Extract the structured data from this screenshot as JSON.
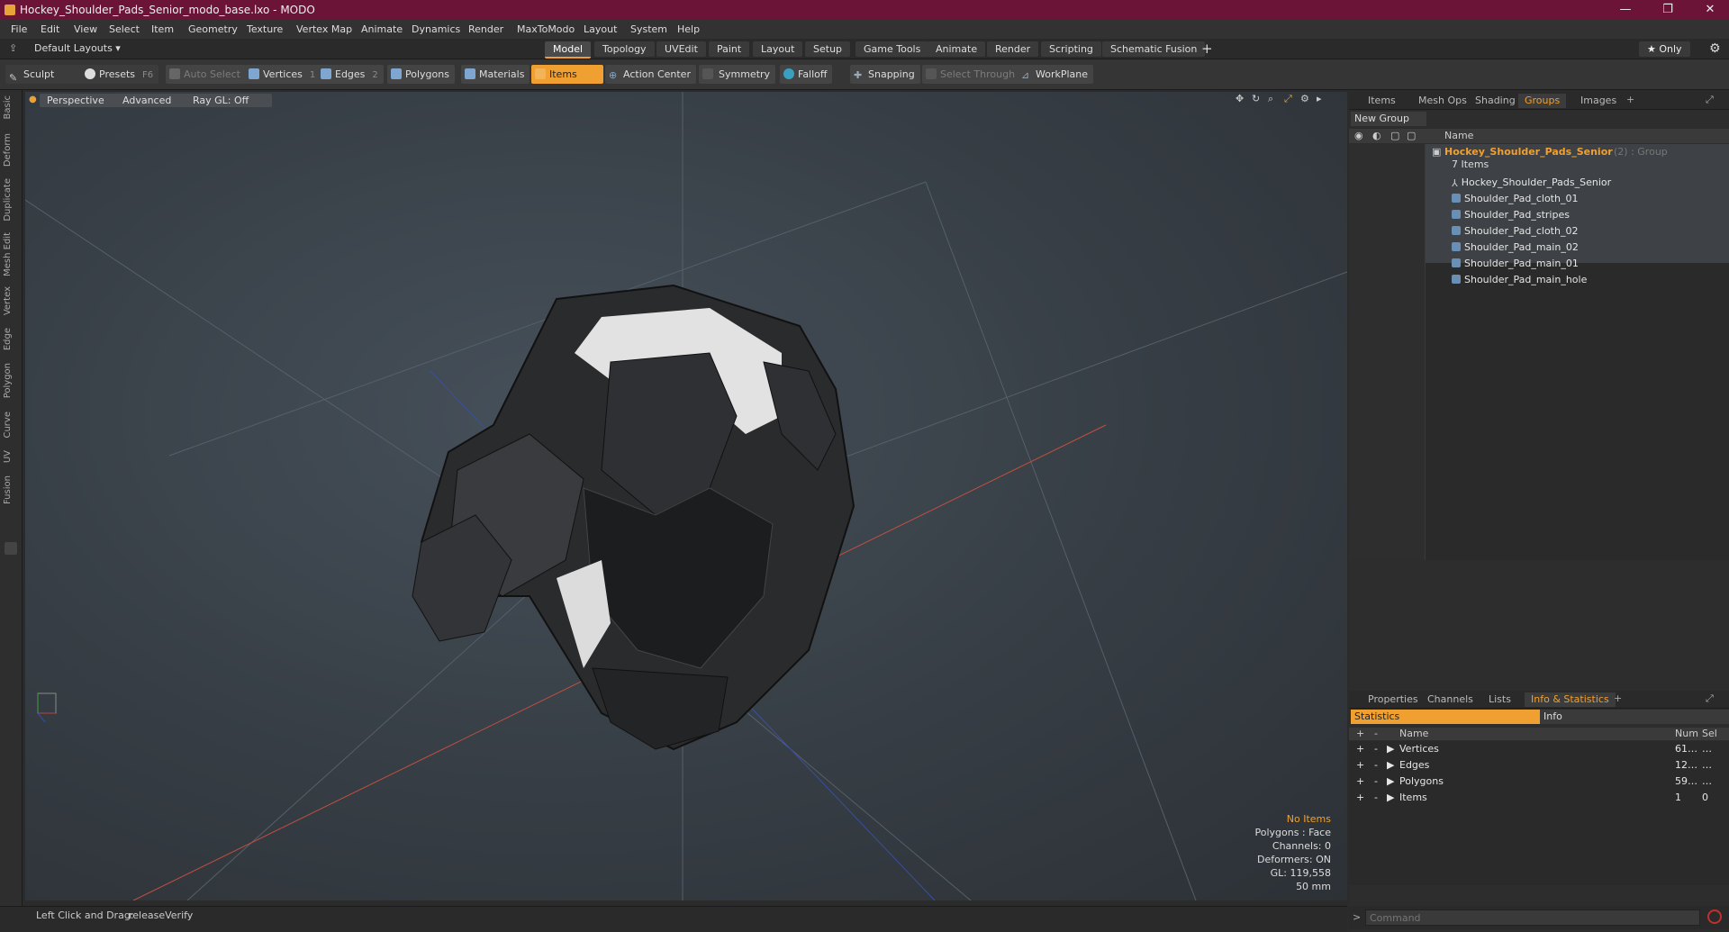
{
  "window": {
    "title": "Hockey_Shoulder_Pads_Senior_modo_base.lxo - MODO",
    "minimize_glyph": "—",
    "restore_glyph": "❐",
    "close_glyph": "✕"
  },
  "menu": [
    "File",
    "Edit",
    "View",
    "Select",
    "Item",
    "Geometry",
    "Texture",
    "Vertex Map",
    "Animate",
    "Dynamics",
    "Render",
    "MaxToModo",
    "Layout",
    "System",
    "Help"
  ],
  "layoutbar": {
    "preset": "Default Layouts ▾",
    "tabs": [
      "Model",
      "Topology",
      "UVEdit",
      "Paint",
      "Layout",
      "Setup",
      "Game Tools",
      "Animate",
      "Render",
      "Scripting",
      "Schematic Fusion"
    ],
    "active_tab": "Model",
    "add_glyph": "+",
    "only_label": "★ Only"
  },
  "toolbar": {
    "sculpt": "Sculpt",
    "presets": "Presets",
    "presets_key": "F6",
    "auto_select": "Auto Select",
    "vertices": "Vertices",
    "vertices_count": "1",
    "edges": "Edges",
    "edges_count": "2",
    "polygons": "Polygons",
    "materials": "Materials",
    "items": "Items",
    "action_center": "Action Center",
    "symmetry": "Symmetry",
    "falloff": "Falloff",
    "snapping": "Snapping",
    "select_through": "Select Through",
    "workplane": "WorkPlane"
  },
  "left_tabs": [
    "Basic",
    "Deform",
    "Duplicate",
    "Mesh Edit",
    "Vertex",
    "Edge",
    "Polygon",
    "Curve",
    "UV",
    "Fusion"
  ],
  "viewport": {
    "perspective": "Perspective",
    "advanced": "Advanced",
    "raygl": "Ray GL: Off",
    "stats": {
      "selection": "No Items",
      "polygons": "Polygons : Face",
      "channels": "Channels: 0",
      "deformers": "Deformers: ON",
      "gl": "GL: 119,558",
      "scale": "50 mm"
    }
  },
  "status": {
    "hint": "Left Click and Drag:",
    "action": "releaseVerify"
  },
  "right_top": {
    "tabs": [
      "Items",
      "Mesh Ops",
      "Shading",
      "Groups",
      "Images"
    ],
    "active_tab": "Groups",
    "new_group": "New Group",
    "name_header": "Name",
    "group_name": "Hockey_Shoulder_Pads_Senior",
    "group_suffix": "(2) : Group",
    "group_count": "7 Items",
    "children": [
      "Hockey_Shoulder_Pads_Senior",
      "Shoulder_Pad_cloth_01",
      "Shoulder_Pad_stripes",
      "Shoulder_Pad_cloth_02",
      "Shoulder_Pad_main_02",
      "Shoulder_Pad_main_01",
      "Shoulder_Pad_main_hole"
    ]
  },
  "right_bottom": {
    "tabs": [
      "Properties",
      "Channels",
      "Lists",
      "Info & Statistics"
    ],
    "active_tab": "Info & Statistics",
    "statistics_label": "Statistics",
    "info_label": "Info",
    "headers": {
      "name": "Name",
      "num": "Num",
      "sel": "Sel"
    },
    "rows": [
      {
        "name": "Vertices",
        "num": "61…",
        "sel": "…"
      },
      {
        "name": "Edges",
        "num": "12…",
        "sel": "…"
      },
      {
        "name": "Polygons",
        "num": "59…",
        "sel": "…"
      },
      {
        "name": "Items",
        "num": "1",
        "sel": "0"
      }
    ],
    "command_placeholder": "Command"
  },
  "colors": {
    "title_bg": "#6b1438",
    "accent": "#f0a030"
  }
}
